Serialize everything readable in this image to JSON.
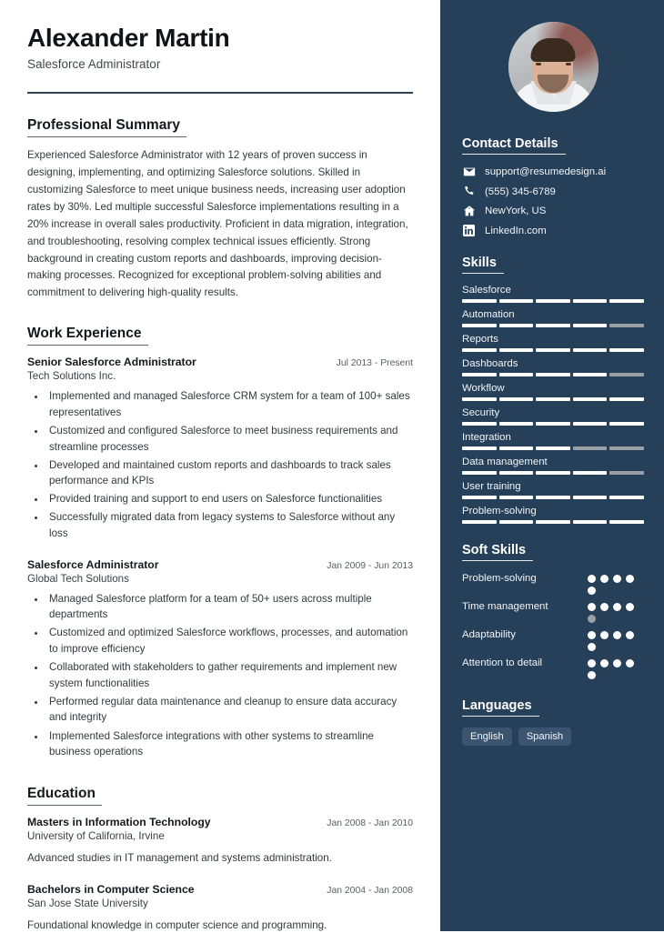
{
  "header": {
    "name": "Alexander Martin",
    "title": "Salesforce Administrator"
  },
  "sections": {
    "summary_heading": "Professional Summary",
    "experience_heading": "Work Experience",
    "education_heading": "Education"
  },
  "summary": {
    "text": "Experienced Salesforce Administrator with 12 years of proven success in designing, implementing, and optimizing Salesforce solutions. Skilled in customizing Salesforce to meet unique business needs, increasing user adoption rates by 30%. Led multiple successful Salesforce implementations resulting in a 20% increase in overall sales productivity. Proficient in data migration, integration, and troubleshooting, resolving complex technical issues efficiently. Strong background in creating custom reports and dashboards, improving decision-making processes. Recognized for exceptional problem-solving abilities and commitment to delivering high-quality results."
  },
  "experience": [
    {
      "role": "Senior Salesforce Administrator",
      "organization": "Tech Solutions Inc.",
      "dates": "Jul 2013 - Present",
      "bullets": [
        "Implemented and managed Salesforce CRM system for a team of 100+ sales representatives",
        "Customized and configured Salesforce to meet business requirements and streamline processes",
        "Developed and maintained custom reports and dashboards to track sales performance and KPIs",
        "Provided training and support to end users on Salesforce functionalities",
        "Successfully migrated data from legacy systems to Salesforce without any loss"
      ]
    },
    {
      "role": "Salesforce Administrator",
      "organization": "Global Tech Solutions",
      "dates": "Jan 2009 - Jun 2013",
      "bullets": [
        "Managed Salesforce platform for a team of 50+ users across multiple departments",
        "Customized and optimized Salesforce workflows, processes, and automation to improve efficiency",
        "Collaborated with stakeholders to gather requirements and implement new system functionalities",
        "Performed regular data maintenance and cleanup to ensure data accuracy and integrity",
        "Implemented Salesforce integrations with other systems to streamline business operations"
      ]
    }
  ],
  "education": [
    {
      "degree": "Masters in Information Technology",
      "school": "University of California, Irvine",
      "dates": "Jan 2008 - Jan 2010",
      "description": "Advanced studies in IT management and systems administration."
    },
    {
      "degree": "Bachelors in Computer Science",
      "school": "San Jose State University",
      "dates": "Jan 2004 - Jan 2008",
      "description": "Foundational knowledge in computer science and programming."
    }
  ],
  "sidebar": {
    "contact_heading": "Contact Details",
    "contact": [
      {
        "icon": "envelope-icon",
        "value": "support@resumedesign.ai"
      },
      {
        "icon": "phone-icon",
        "value": "(555) 345-6789"
      },
      {
        "icon": "home-icon",
        "value": "NewYork, US"
      },
      {
        "icon": "linkedin-icon",
        "value": "LinkedIn.com"
      }
    ],
    "skills_heading": "Skills",
    "skills": [
      {
        "name": "Salesforce",
        "level": 5,
        "max": 5
      },
      {
        "name": "Automation",
        "level": 4,
        "max": 5
      },
      {
        "name": "Reports",
        "level": 5,
        "max": 5
      },
      {
        "name": "Dashboards",
        "level": 4,
        "max": 5
      },
      {
        "name": "Workflow",
        "level": 5,
        "max": 5
      },
      {
        "name": "Security",
        "level": 5,
        "max": 5
      },
      {
        "name": "Integration",
        "level": 3,
        "max": 5
      },
      {
        "name": "Data management",
        "level": 4,
        "max": 5
      },
      {
        "name": "User training",
        "level": 5,
        "max": 5
      },
      {
        "name": "Problem-solving",
        "level": 5,
        "max": 5
      }
    ],
    "soft_skills_heading": "Soft Skills",
    "soft_skills": [
      {
        "name": "Problem-solving",
        "level": 5,
        "max": 5
      },
      {
        "name": "Time management",
        "level": 4,
        "max": 5
      },
      {
        "name": "Adaptability",
        "level": 5,
        "max": 5
      },
      {
        "name": "Attention to detail",
        "level": 5,
        "max": 5
      }
    ],
    "languages_heading": "Languages",
    "languages": [
      "English",
      "Spanish"
    ]
  },
  "colors": {
    "sidebar_bg": "#27405a",
    "rule": "#2b4156",
    "chip_bg": "#3b5570",
    "meter_on": "#ffffff",
    "meter_off": "#9aa0a6"
  }
}
